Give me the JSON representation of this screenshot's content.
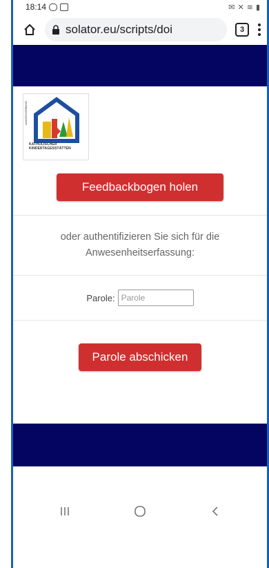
{
  "statusbar": {
    "time": "18:14"
  },
  "browser": {
    "url": "solator.eu/scripts/doi",
    "tab_count": "3"
  },
  "logo": {
    "vertical_text": "LANDESVERBAND",
    "caption_line1": "KATHOLISCHER",
    "caption_line2": "KINDERTAGESSTÄTTEN"
  },
  "feedback": {
    "button_label": "Feedbackbogen holen"
  },
  "auth": {
    "text": "oder authentifizieren Sie sich für die Anwesenheitserfassung:"
  },
  "parole": {
    "label": "Parole:",
    "placeholder": "Parole",
    "value": "",
    "submit_label": "Parole abschicken"
  },
  "colors": {
    "navy": "#030560",
    "button_red": "#d02f2f"
  },
  "icons": {
    "home": "home-icon",
    "lock": "lock-icon",
    "menu": "more-vert-icon",
    "recent": "recent-apps-icon",
    "home_nav": "home-circle-icon",
    "back": "back-icon"
  }
}
